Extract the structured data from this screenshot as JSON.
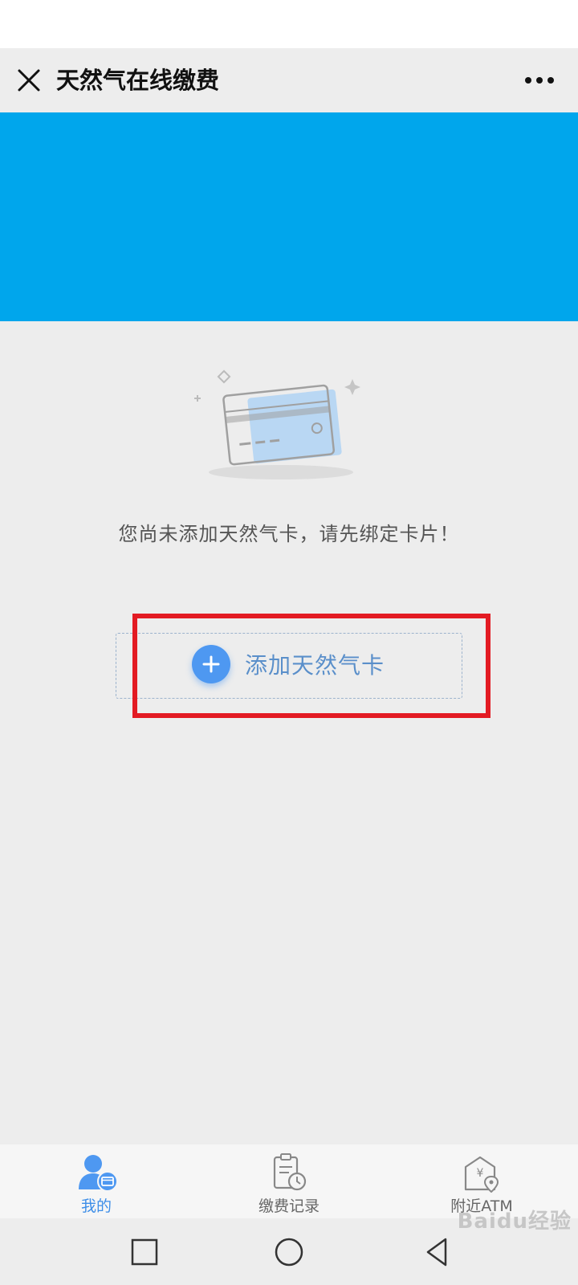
{
  "header": {
    "title": "天然气在线缴费"
  },
  "empty_state": {
    "message": "您尚未添加天然气卡，请先绑定卡片！"
  },
  "add_card": {
    "label": "添加天然气卡"
  },
  "tabs": [
    {
      "label": "我的",
      "icon": "user-card-icon",
      "active": true
    },
    {
      "label": "缴费记录",
      "icon": "payment-record-icon",
      "active": false
    },
    {
      "label": "附近ATM",
      "icon": "atm-location-icon",
      "active": false
    }
  ],
  "watermark": "Baidu经验",
  "colors": {
    "banner": "#00a6ec",
    "accent": "#4e98f1",
    "highlight": "#e31b23"
  }
}
